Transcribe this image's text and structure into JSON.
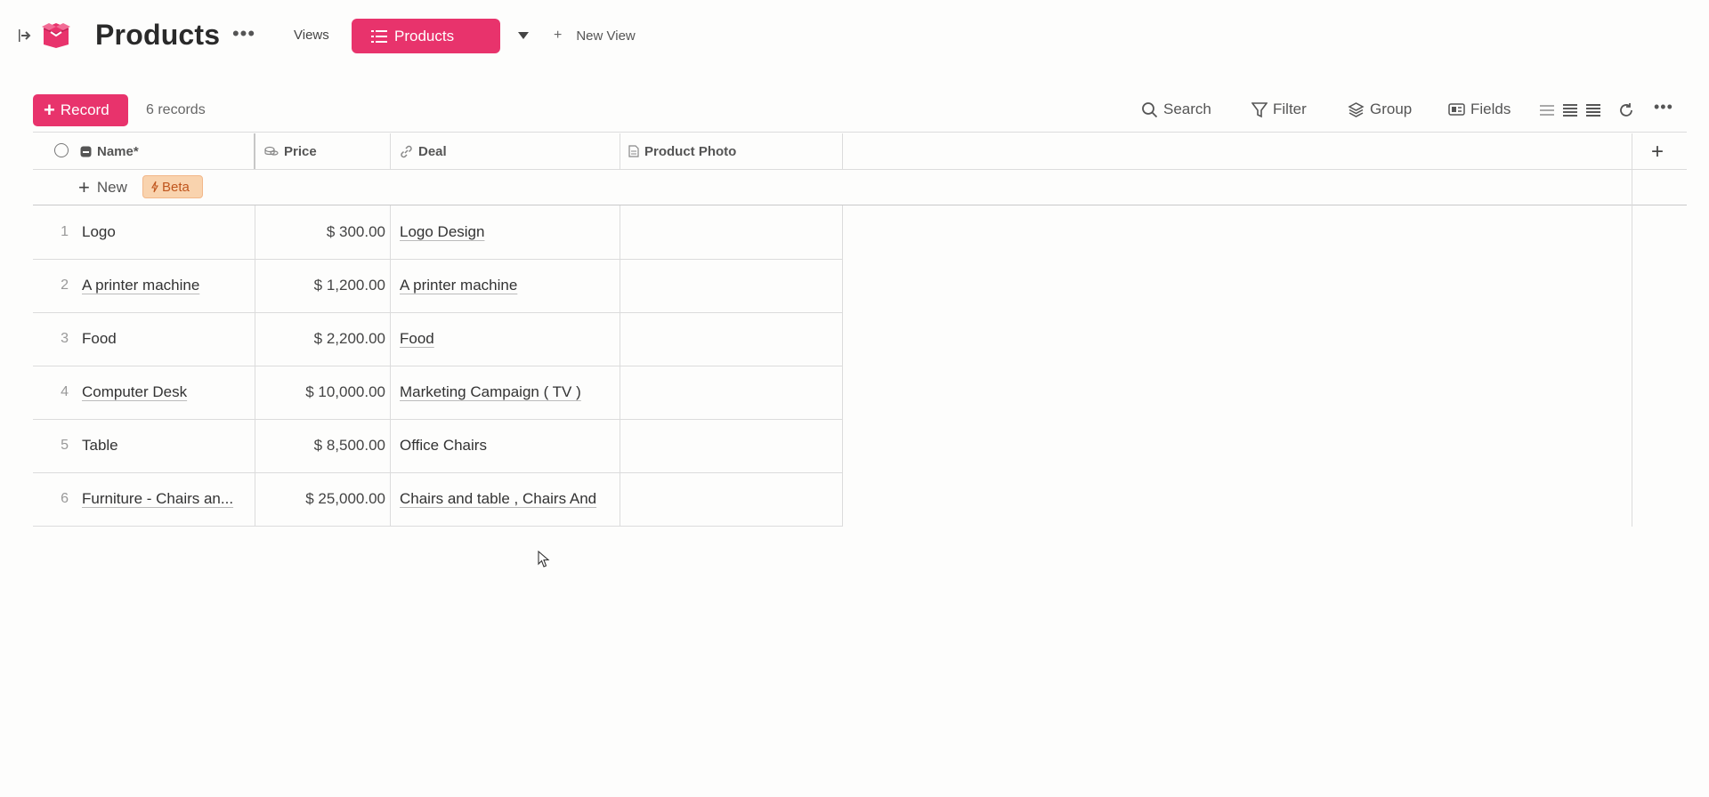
{
  "header": {
    "title": "Products",
    "views_label": "Views",
    "active_view": "Products",
    "new_view_label": "New View"
  },
  "toolbar": {
    "record_label": "Record",
    "records_count": "6 records",
    "search_label": "Search",
    "filter_label": "Filter",
    "group_label": "Group",
    "fields_label": "Fields"
  },
  "columns": {
    "name": "Name*",
    "price": "Price",
    "deal": "Deal",
    "photo": "Product Photo"
  },
  "new_row": {
    "label": "New",
    "badge": "Beta"
  },
  "rows": [
    {
      "num": "1",
      "name": "Logo",
      "price": "$ 300.00",
      "deal": "Logo Design"
    },
    {
      "num": "2",
      "name": "A printer machine",
      "price": "$ 1,200.00",
      "deal": "A printer machine"
    },
    {
      "num": "3",
      "name": "Food",
      "price": "$ 2,200.00",
      "deal": "Food"
    },
    {
      "num": "4",
      "name": "Computer Desk",
      "price": "$ 10,000.00",
      "deal": "Marketing Campaign ( TV )"
    },
    {
      "num": "5",
      "name": "Table",
      "price": "$ 8,500.00",
      "deal": "Office Chairs"
    },
    {
      "num": "6",
      "name": "Furniture - Chairs an...",
      "price": "$ 25,000.00",
      "deal": "Chairs and table  ,  Chairs And"
    }
  ],
  "colors": {
    "accent": "#e8336c",
    "beta_bg": "#f9d3ae",
    "beta_text": "#c0561e"
  }
}
